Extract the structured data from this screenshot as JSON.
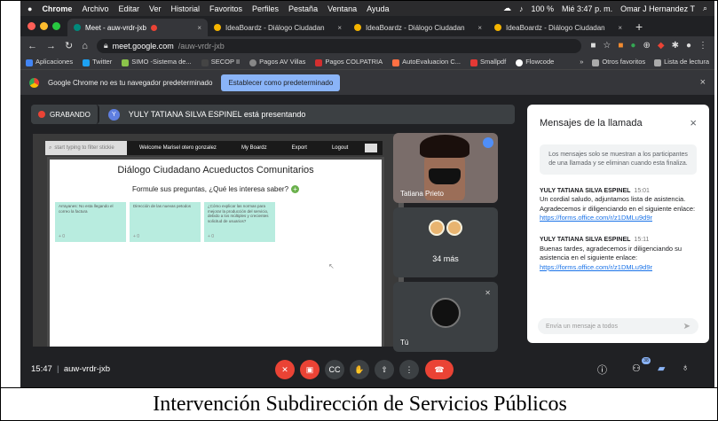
{
  "caption": "Intervención Subdirección de Servicios Públicos",
  "mac_menu": {
    "app": "Chrome",
    "items": [
      "Archivo",
      "Editar",
      "Ver",
      "Historial",
      "Favoritos",
      "Perfiles",
      "Pestaña",
      "Ventana",
      "Ayuda"
    ],
    "battery": "100 %",
    "datetime": "Mié 3:47 p. m.",
    "user": "Omar J Hernandez T"
  },
  "tabs": [
    {
      "title": "Meet - auw-vrdr-jxb"
    },
    {
      "title": "IdeaBoardz - Diálogo Ciudadan"
    },
    {
      "title": "IdeaBoardz - Diálogo Ciudadan"
    },
    {
      "title": "IdeaBoardz - Diálogo Ciudadan"
    }
  ],
  "address": {
    "host": "meet.google.com",
    "path": "/auw-vrdr-jxb"
  },
  "bookmarks": {
    "items": [
      "Aplicaciones",
      "Twitter",
      "SIMO -Sistema de...",
      "SECOP II",
      "Pagos AV Villas",
      "Pagos COLPATRIA",
      "AutoEvaluacion C...",
      "Smallpdf",
      "Flowcode"
    ],
    "more": "»",
    "others": "Otros favoritos",
    "reading_list": "Lista de lectura"
  },
  "infobar": {
    "message": "Google Chrome no es tu navegador predeterminado",
    "button": "Establecer como predeterminado"
  },
  "meet": {
    "recording": "GRABANDO",
    "presenter_initial": "Y",
    "presenting": "YULY TATIANA SILVA ESPINEL está presentando",
    "ideaboard": {
      "search_placeholder": "start typing to filter stickie",
      "welcome": "Welcome Marisel otero gonzalez",
      "my_boardz": "My Boardz",
      "export": "Export",
      "logout": "Logout",
      "title": "Diálogo Ciudadano Acueductos Comunitarios",
      "subtitle": "Formule sus preguntas, ¿Qué les interesa saber?",
      "plus": "+",
      "cards": [
        {
          "text": "Arrayanes: No esta llegando el correo la factura",
          "votes": "+ 0"
        },
        {
          "text": "Dirección de las nuevas petodos",
          "votes": "+ 0"
        },
        {
          "text": "¿Cómo explicar las normas para mejorar la producción del servicio, debido a los múltiples y crecientes solicitud de usuarios?",
          "votes": "+ 0"
        }
      ]
    },
    "tile_name": "Tatiana Prieto",
    "more_count": "34 más",
    "self_label": "Tú",
    "time": "15:47",
    "code": "auw-vrdr-jxb",
    "participants_badge": "38"
  },
  "chat": {
    "title": "Mensajes de la llamada",
    "note": "Los mensajes solo se muestran a los participantes de una llamada y se eliminan cuando esta finaliza.",
    "messages": [
      {
        "sender": "YULY TATIANA SILVA ESPINEL",
        "time": "15:01",
        "text": "Un cordial saludo, adjuntamos lista de asistencia. Agradecemos ir diligenciando en el siguiente enlace:",
        "link": "https://forms.office.com/r/z1DMLu9d9r"
      },
      {
        "sender": "YULY TATIANA SILVA ESPINEL",
        "time": "15:11",
        "text": "Buenas tardes, agradecemos ir diligenciando su asistencia en el siguiente enlace:",
        "link": "https://forms.office.com/r/z1DMLu9d9r"
      }
    ],
    "input_placeholder": "Envía un mensaje a todos"
  }
}
